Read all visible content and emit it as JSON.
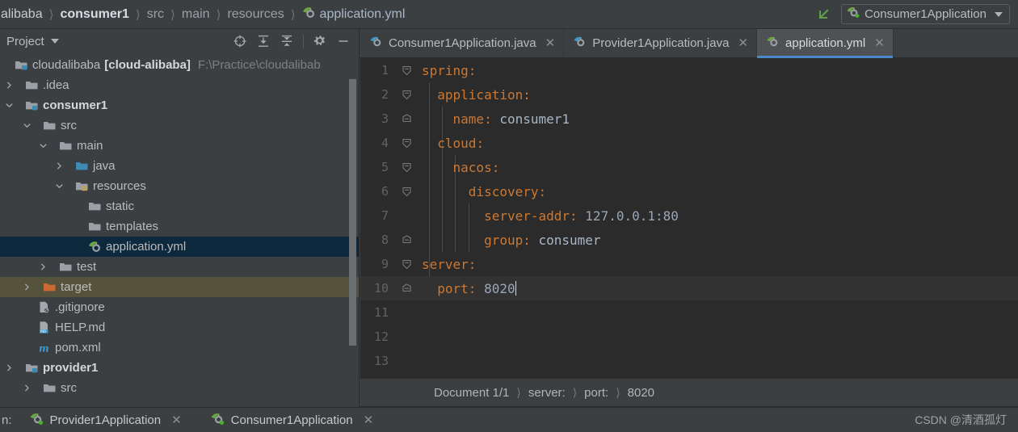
{
  "topbar": {
    "breadcrumbs": [
      {
        "text": "alibaba",
        "style": "first",
        "icon": null
      },
      {
        "text": "consumer1",
        "style": "bold",
        "icon": null
      },
      {
        "text": "src",
        "style": "dim",
        "icon": null
      },
      {
        "text": "main",
        "style": "dim",
        "icon": null
      },
      {
        "text": "resources",
        "style": "dim",
        "icon": null
      },
      {
        "text": "application.yml",
        "style": "plain",
        "icon": "spring-yaml-icon"
      }
    ],
    "run_arrow_icon": "run-arrow-icon",
    "run_config": {
      "label": "Consumer1Application",
      "icon": "spring-boot-run-icon",
      "dropdown_icon": "chevron-down-icon"
    }
  },
  "project_panel": {
    "title": "Project",
    "title_dropdown_icon": "chevron-down-icon",
    "tools": [
      {
        "name": "select-opened-file-icon",
        "label": "Select Opened File"
      },
      {
        "name": "expand-all-icon",
        "label": "Expand All"
      },
      {
        "name": "collapse-all-icon",
        "label": "Collapse All"
      },
      {
        "name": "gear-icon",
        "label": "Settings"
      },
      {
        "name": "hide-icon",
        "label": "Hide"
      }
    ],
    "tree": [
      {
        "label": "cloudalibaba",
        "bracket": "[cloud-alibaba]",
        "hint": "F:\\Practice\\cloudalibab",
        "indent": 0,
        "twisty": "none",
        "icon": "module-icon",
        "bold": false,
        "state": "normal"
      },
      {
        "label": ".idea",
        "indent": 0,
        "twisty": "collapsed",
        "icon": "folder-icon",
        "bold": false,
        "state": "normal"
      },
      {
        "label": "consumer1",
        "indent": 0,
        "twisty": "expanded",
        "icon": "module-icon",
        "bold": true,
        "state": "normal"
      },
      {
        "label": "src",
        "indent": 1,
        "twisty": "expanded",
        "icon": "folder-icon",
        "bold": false,
        "state": "normal"
      },
      {
        "label": "main",
        "indent": 2,
        "twisty": "expanded",
        "icon": "folder-icon",
        "bold": false,
        "state": "normal"
      },
      {
        "label": "java",
        "indent": 3,
        "twisty": "collapsed",
        "icon": "source-folder-icon",
        "bold": false,
        "state": "normal"
      },
      {
        "label": "resources",
        "indent": 3,
        "twisty": "expanded",
        "icon": "resources-folder-icon",
        "bold": false,
        "state": "normal"
      },
      {
        "label": "static",
        "indent": 4,
        "twisty": "none",
        "icon": "folder-icon",
        "bold": false,
        "state": "normal"
      },
      {
        "label": "templates",
        "indent": 4,
        "twisty": "none",
        "icon": "folder-icon",
        "bold": false,
        "state": "normal"
      },
      {
        "label": "application.yml",
        "indent": 4,
        "twisty": "none",
        "icon": "spring-yaml-icon",
        "bold": false,
        "state": "selected"
      },
      {
        "label": "test",
        "indent": 2,
        "twisty": "collapsed",
        "icon": "folder-icon",
        "bold": false,
        "state": "normal"
      },
      {
        "label": "target",
        "indent": 1,
        "twisty": "collapsed",
        "icon": "excluded-folder-icon",
        "bold": false,
        "state": "excluded"
      },
      {
        "label": ".gitignore",
        "indent": 2,
        "twisty": "none",
        "icon": "gitignore-icon",
        "bold": false,
        "state": "normal"
      },
      {
        "label": "HELP.md",
        "indent": 2,
        "twisty": "none",
        "icon": "markdown-icon",
        "bold": false,
        "state": "normal"
      },
      {
        "label": "pom.xml",
        "indent": 2,
        "twisty": "none",
        "icon": "maven-icon",
        "bold": false,
        "state": "normal"
      },
      {
        "label": "provider1",
        "indent": 0,
        "twisty": "collapsed",
        "icon": "module-icon",
        "bold": true,
        "state": "normal"
      },
      {
        "label": "src",
        "indent": 1,
        "twisty": "collapsed",
        "icon": "folder-icon",
        "bold": false,
        "state": "normal"
      }
    ]
  },
  "editor": {
    "tabs": [
      {
        "label": "Consumer1Application.java",
        "icon": "java-spring-icon",
        "active": false,
        "close_icon": "close-icon"
      },
      {
        "label": "Provider1Application.java",
        "icon": "java-spring-icon",
        "active": false,
        "close_icon": "close-icon"
      },
      {
        "label": "application.yml",
        "icon": "spring-yaml-icon",
        "active": true,
        "close_icon": "close-icon"
      }
    ],
    "lines": [
      {
        "n": "1",
        "fold": "expanded",
        "indent": 0,
        "key": "spring",
        "value": "",
        "current": false
      },
      {
        "n": "2",
        "fold": "expanded",
        "indent": 1,
        "key": "application",
        "value": "",
        "current": false
      },
      {
        "n": "3",
        "fold": "end",
        "indent": 2,
        "key": "name",
        "value": "consumer1",
        "current": false
      },
      {
        "n": "4",
        "fold": "expanded",
        "indent": 1,
        "key": "cloud",
        "value": "",
        "current": false
      },
      {
        "n": "5",
        "fold": "expanded",
        "indent": 2,
        "key": "nacos",
        "value": "",
        "current": false
      },
      {
        "n": "6",
        "fold": "expanded",
        "indent": 3,
        "key": "discovery",
        "value": "",
        "current": false
      },
      {
        "n": "7",
        "fold": "none",
        "indent": 4,
        "key": "server-addr",
        "value": "127.0.0.1:80",
        "current": false
      },
      {
        "n": "8",
        "fold": "end",
        "indent": 4,
        "key": "group",
        "value": "consumer",
        "current": false
      },
      {
        "n": "9",
        "fold": "expanded",
        "indent": 0,
        "key": "server",
        "value": "",
        "current": false
      },
      {
        "n": "10",
        "fold": "end",
        "indent": 1,
        "key": "port",
        "value": "8020",
        "current": true,
        "caret": true
      },
      {
        "n": "11",
        "fold": "none",
        "indent": 0,
        "key": "",
        "value": "",
        "current": false
      },
      {
        "n": "12",
        "fold": "none",
        "indent": 0,
        "key": "",
        "value": "",
        "current": false
      },
      {
        "n": "13",
        "fold": "none",
        "indent": 0,
        "key": "",
        "value": "",
        "current": false
      }
    ],
    "status_breadcrumb": [
      "Document 1/1",
      "server:",
      "port:",
      "8020"
    ]
  },
  "bottombar": {
    "prefix": "n:",
    "tabs": [
      {
        "label": "Provider1Application",
        "icon": "spring-boot-run-icon",
        "close_icon": "close-icon"
      },
      {
        "label": "Consumer1Application",
        "icon": "spring-boot-run-icon",
        "close_icon": "close-icon"
      }
    ],
    "watermark": "CSDN @清酒孤灯"
  },
  "colors": {
    "panel_bg": "#3c3f41",
    "editor_bg": "#2b2b2b",
    "tab_active_bg": "#4e5254",
    "tab_underline": "#4a88c7",
    "tree_selected_bg": "#0d293e",
    "excluded_bg": "#56533c",
    "yaml_key": "#cc7832",
    "yaml_value": "#a9b7c6",
    "line_number": "#606366",
    "spring_green": "#6aaa3c",
    "folder_gray": "#9aa0a5",
    "folder_blue": "#3d8ab5",
    "maven_blue": "#3d9ad1"
  }
}
